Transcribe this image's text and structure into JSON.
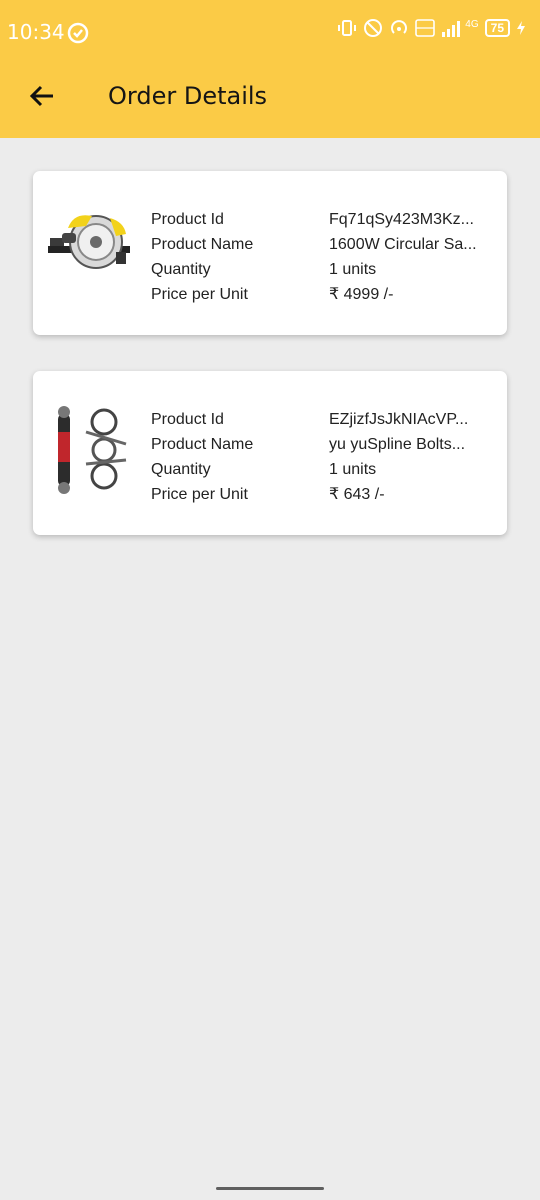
{
  "status_bar": {
    "time": "10:34",
    "network": "4G",
    "battery": "75"
  },
  "toolbar": {
    "title": "Order Details"
  },
  "orders": [
    {
      "product_image": "circular-saw-image",
      "labels": {
        "product_id": "Product Id",
        "product_name": "Product Name",
        "quantity": "Quantity",
        "price_per_unit": "Price per Unit"
      },
      "values": {
        "product_id": "Fq71qSy423M3Kz...",
        "product_name": "1600W Circular Sa...",
        "quantity": "1 units",
        "price_per_unit": "₹ 4999 /-"
      }
    },
    {
      "product_image": "wrench-set-image",
      "labels": {
        "product_id": "Product Id",
        "product_name": "Product Name",
        "quantity": "Quantity",
        "price_per_unit": "Price per Unit"
      },
      "values": {
        "product_id": "EZjizfJsJkNIAcVP...",
        "product_name": "yu yuSpline Bolts...",
        "quantity": "1 units",
        "price_per_unit": "₹ 643 /-"
      }
    }
  ],
  "colors": {
    "appbar": "#fbcb46",
    "background": "#ececec",
    "card": "#ffffff"
  }
}
